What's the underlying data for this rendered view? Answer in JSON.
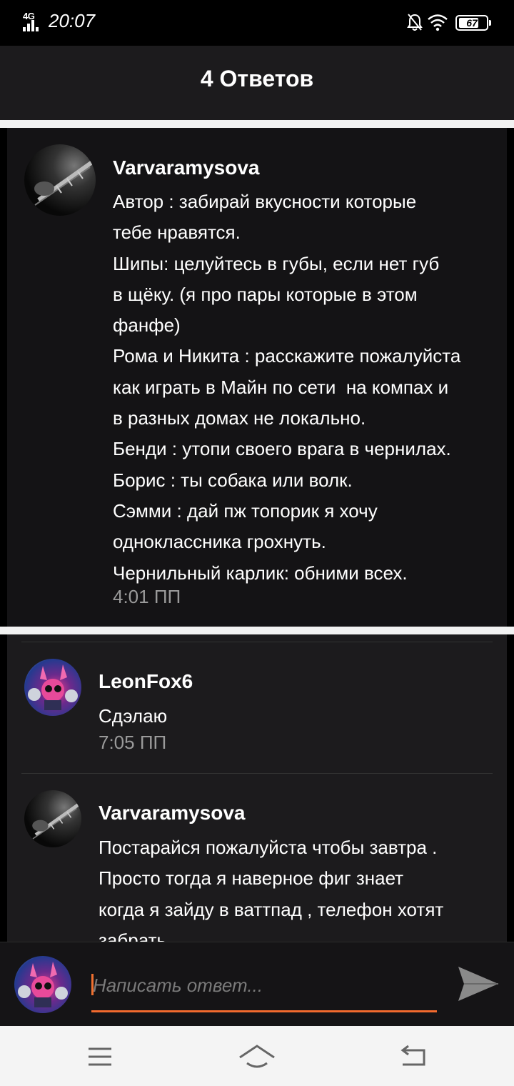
{
  "status_bar": {
    "network": "4G",
    "time": "20:07",
    "battery": "67",
    "icons": [
      "signal-icon",
      "bell-off-icon",
      "wifi-icon",
      "battery-icon"
    ]
  },
  "header": {
    "title": "4 Ответов"
  },
  "main_comment": {
    "author": "Varvaramysova",
    "body": "Автор : забирай вкусности которые\nтебе нравятся.\nШипы: целуйтесь в губы, если нет губ\nв щёку. (я про пары которые в этом\nфанфе)\nРома и Никита : расскажите пожалуйста\nкак играть в Майн по сети  на компах и\nв разных домах не локально.\nБенди : утопи своего врага в чернилах.\nБорис : ты собака или волк.\nСэмми : дай пж топорик я хочу\nодноклассника грохнуть.\nЧернильный карлик: обними всех.",
    "time": "4:01 ПП"
  },
  "replies": [
    {
      "author": "LeonFox6",
      "body": "Сдэлаю",
      "time": "7:05 ПП"
    },
    {
      "author": "Varvaramysova",
      "body": "Постарайся пожалуйста чтобы завтра .\nПросто тогда я наверное фиг знает\nкогда я зайду в ваттпад , телефон хотят\nзабрать"
    }
  ],
  "composer": {
    "placeholder": "Написать ответ..."
  },
  "colors": {
    "accent": "#f26a2e",
    "background": "#1c1b1d",
    "main_card": "#141315",
    "timestamp": "#9a9a9a"
  },
  "nav": {
    "icons": [
      "menu-icon",
      "home-icon",
      "back-icon"
    ]
  }
}
